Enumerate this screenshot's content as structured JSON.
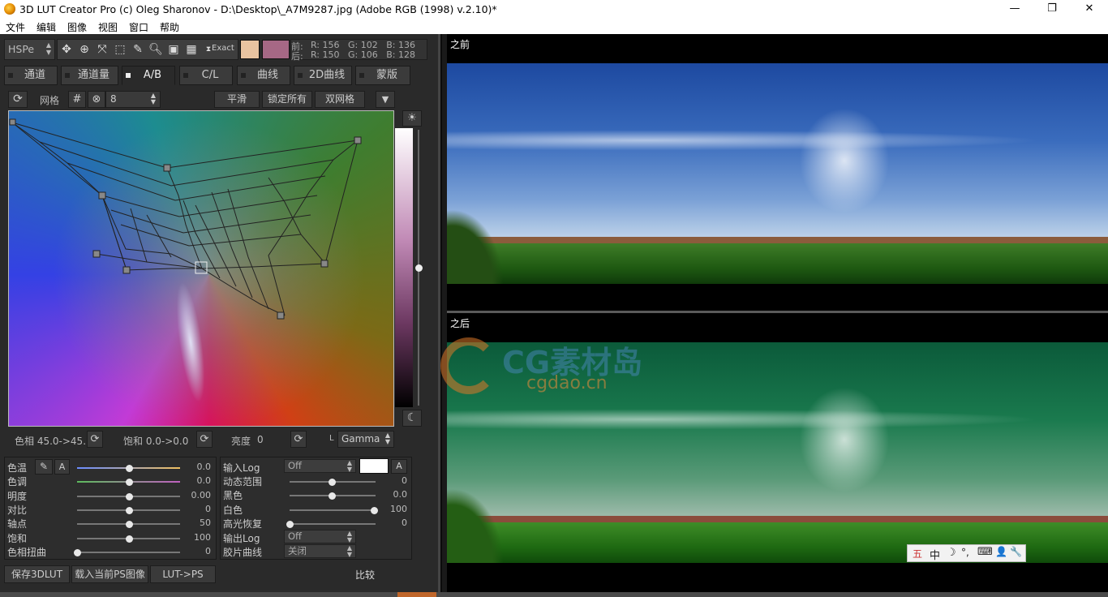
{
  "window": {
    "title": "3D LUT Creator Pro (c) Oleg Sharonov - D:\\Desktop\\_A7M9287.jpg (Adobe RGB (1998) v.2.10)*",
    "min_glyph": "—",
    "max_glyph": "❐",
    "close_glyph": "✕"
  },
  "menu": [
    "文件",
    "编辑",
    "图像",
    "视图",
    "窗口",
    "帮助"
  ],
  "toolbar": {
    "mode_select": "HSPe",
    "exact_label": "Exact",
    "swatch_before": "#e8c3a0",
    "swatch_after": "#a66885",
    "before_label": "前:",
    "after_label": "后:",
    "before_rgb": "R: 156   G: 102   B: 136",
    "after_rgb": "R: 150   G: 106   B: 128"
  },
  "tabs": [
    "通道",
    "通道量",
    "A/B",
    "C/L",
    "曲线",
    "2D曲线",
    "蒙版"
  ],
  "active_tab": "A/B",
  "grid_row": {
    "grid_label": "网格",
    "grid_value": "8",
    "smooth_btn": "平滑",
    "lock_all_btn": "锁定所有",
    "double_grid_btn": "双网格"
  },
  "hsl_row": {
    "hue": "色相 45.0->45.0",
    "saturation": "饱和 0.0->0.0",
    "brightness_label": "亮度",
    "brightness_value": "0",
    "l_label": "L",
    "gamma_select": "Gamma"
  },
  "left_sliders": [
    {
      "label": "色温",
      "value": "0.0",
      "pos": 0.5
    },
    {
      "label": "色调",
      "value": "0.0",
      "pos": 0.5
    },
    {
      "label": "明度",
      "value": "0.00",
      "pos": 0.5
    },
    {
      "label": "对比",
      "value": "0",
      "pos": 0.5
    },
    {
      "label": "轴点",
      "value": "50",
      "pos": 0.5
    },
    {
      "label": "饱和",
      "value": "100",
      "pos": 0.5
    },
    {
      "label": "色相扭曲",
      "value": "0",
      "pos": 0.0
    }
  ],
  "right_sliders": {
    "input_log_label": "输入Log",
    "input_log_value": "Off",
    "a_label": "A",
    "rows": [
      {
        "label": "动态范围",
        "value": "0",
        "pos": 0.5
      },
      {
        "label": "黑色",
        "value": "0.0",
        "pos": 0.5
      },
      {
        "label": "白色",
        "value": "100",
        "pos": 1.0
      },
      {
        "label": "高光恢复",
        "value": "0",
        "pos": 0.0
      }
    ],
    "output_log_label": "输出Log",
    "output_log_value": "Off",
    "film_curve_label": "胶片曲线",
    "film_curve_value": "关闭"
  },
  "bottom_buttons": {
    "save": "保存3DLUT",
    "load_ps": "载入当前PS图像",
    "lut_ps": "LUT->PS",
    "compare": "比较"
  },
  "before_label": "之前",
  "after_label": "之后",
  "watermark": {
    "cn": "CG素材岛",
    "url": "cgdao.cn"
  },
  "ime_bar": [
    "五",
    "中",
    "☽",
    "°,",
    "⌨",
    "👤",
    "🔧"
  ]
}
